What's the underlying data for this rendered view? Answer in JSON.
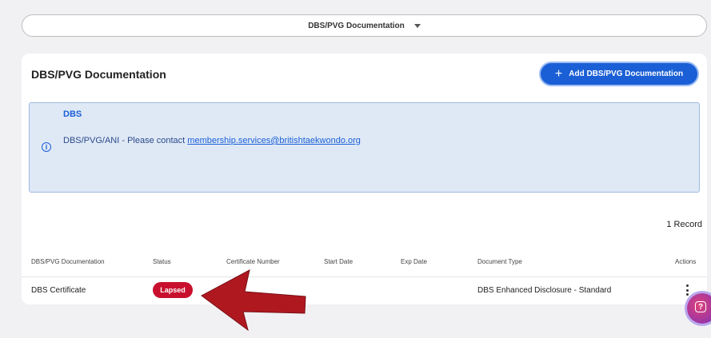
{
  "selector": {
    "label": "DBS/PVG Documentation"
  },
  "card": {
    "title": "DBS/PVG Documentation",
    "add_button_label": "Add DBS/PVG Documentation"
  },
  "info": {
    "title": "DBS",
    "text_prefix": "DBS/PVG/ANI - Please contact ",
    "email": "membership.services@britishtaekwondo.org"
  },
  "record_count": "1 Record",
  "table": {
    "columns": [
      "DBS/PVG Documentation",
      "Status",
      "Certificate Number",
      "Start Date",
      "Exp Date",
      "Document Type",
      "Actions"
    ],
    "rows": [
      {
        "documentation": "DBS Certificate",
        "status": "Lapsed",
        "certificate_number": "",
        "start_date": "",
        "exp_date": "",
        "document_type": "DBS Enhanced Disclosure - Standard"
      }
    ]
  },
  "colors": {
    "primary": "#1a5fd6",
    "lapsed": "#c8102e",
    "annotation_arrow": "#b01820"
  },
  "icons": [
    "chevron-down-icon",
    "plus-icon",
    "info-icon",
    "kebab-menu-icon",
    "help-chat-icon"
  ]
}
